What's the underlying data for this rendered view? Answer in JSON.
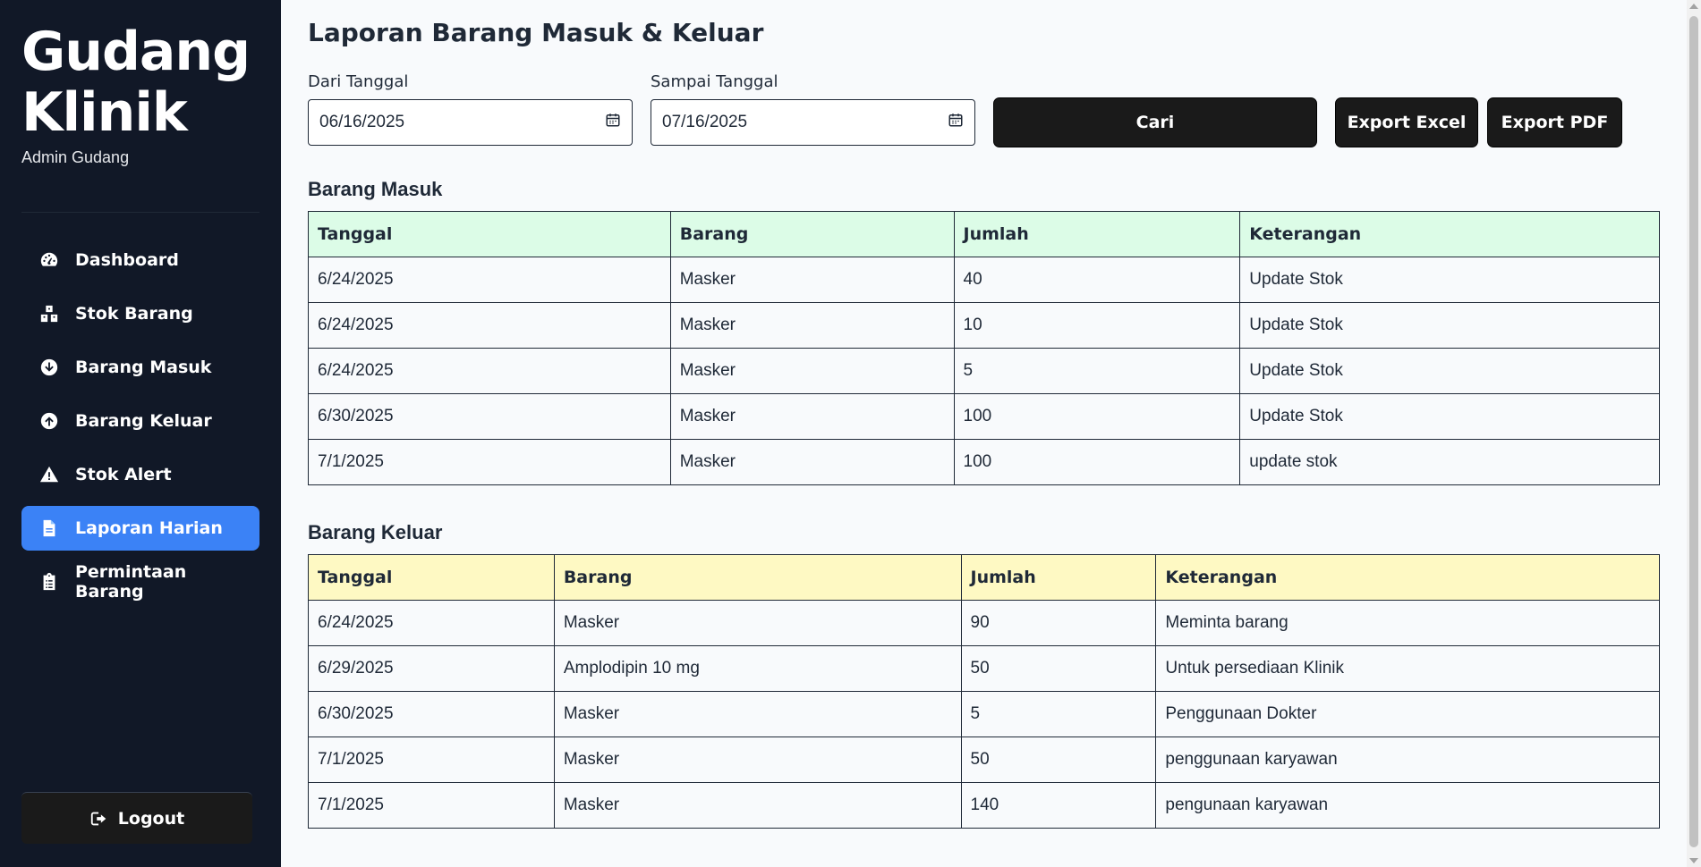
{
  "sidebar": {
    "brand_line1": "Gudang",
    "brand_line2": "Klinik",
    "subtitle": "Admin Gudang",
    "items": [
      {
        "label": "Dashboard",
        "icon": "tachometer-icon",
        "active": false
      },
      {
        "label": "Stok Barang",
        "icon": "boxes-icon",
        "active": false
      },
      {
        "label": "Barang Masuk",
        "icon": "arrow-circle-down-icon",
        "active": false
      },
      {
        "label": "Barang Keluar",
        "icon": "arrow-circle-up-icon",
        "active": false
      },
      {
        "label": "Stok Alert",
        "icon": "warning-icon",
        "active": false
      },
      {
        "label": "Laporan Harian",
        "icon": "file-icon",
        "active": true
      },
      {
        "label": "Permintaan Barang",
        "icon": "clipboard-icon",
        "active": false
      }
    ],
    "logout_label": "Logout"
  },
  "main": {
    "title": "Laporan Barang Masuk & Keluar",
    "filters": {
      "from_label": "Dari Tanggal",
      "from_value": "06/16/2025",
      "to_label": "Sampai Tanggal",
      "to_value": "07/16/2025",
      "search_label": "Cari",
      "export_excel_label": "Export Excel",
      "export_pdf_label": "Export PDF"
    },
    "masuk": {
      "title": "Barang Masuk",
      "headers": [
        "Tanggal",
        "Barang",
        "Jumlah",
        "Keterangan"
      ],
      "rows": [
        [
          "6/24/2025",
          "Masker",
          "40",
          "Update Stok"
        ],
        [
          "6/24/2025",
          "Masker",
          "10",
          "Update Stok"
        ],
        [
          "6/24/2025",
          "Masker",
          "5",
          "Update Stok"
        ],
        [
          "6/30/2025",
          "Masker",
          "100",
          "Update Stok"
        ],
        [
          "7/1/2025",
          "Masker",
          "100",
          "update stok"
        ]
      ]
    },
    "keluar": {
      "title": "Barang Keluar",
      "headers": [
        "Tanggal",
        "Barang",
        "Jumlah",
        "Keterangan"
      ],
      "rows": [
        [
          "6/24/2025",
          "Masker",
          "90",
          "Meminta barang"
        ],
        [
          "6/29/2025",
          "Amplodipin 10 mg",
          "50",
          "Untuk persediaan Klinik"
        ],
        [
          "6/30/2025",
          "Masker",
          "5",
          "Penggunaan Dokter"
        ],
        [
          "7/1/2025",
          "Masker",
          "50",
          "penggunaan karyawan"
        ],
        [
          "7/1/2025",
          "Masker",
          "140",
          "pengunaan karyawan"
        ]
      ]
    }
  },
  "colors": {
    "sidebar_bg": "#111827",
    "active_item": "#3b82f6",
    "button_bg": "#1a1a1a",
    "masuk_header_bg": "#dcfce7",
    "keluar_header_bg": "#fef9c3"
  }
}
